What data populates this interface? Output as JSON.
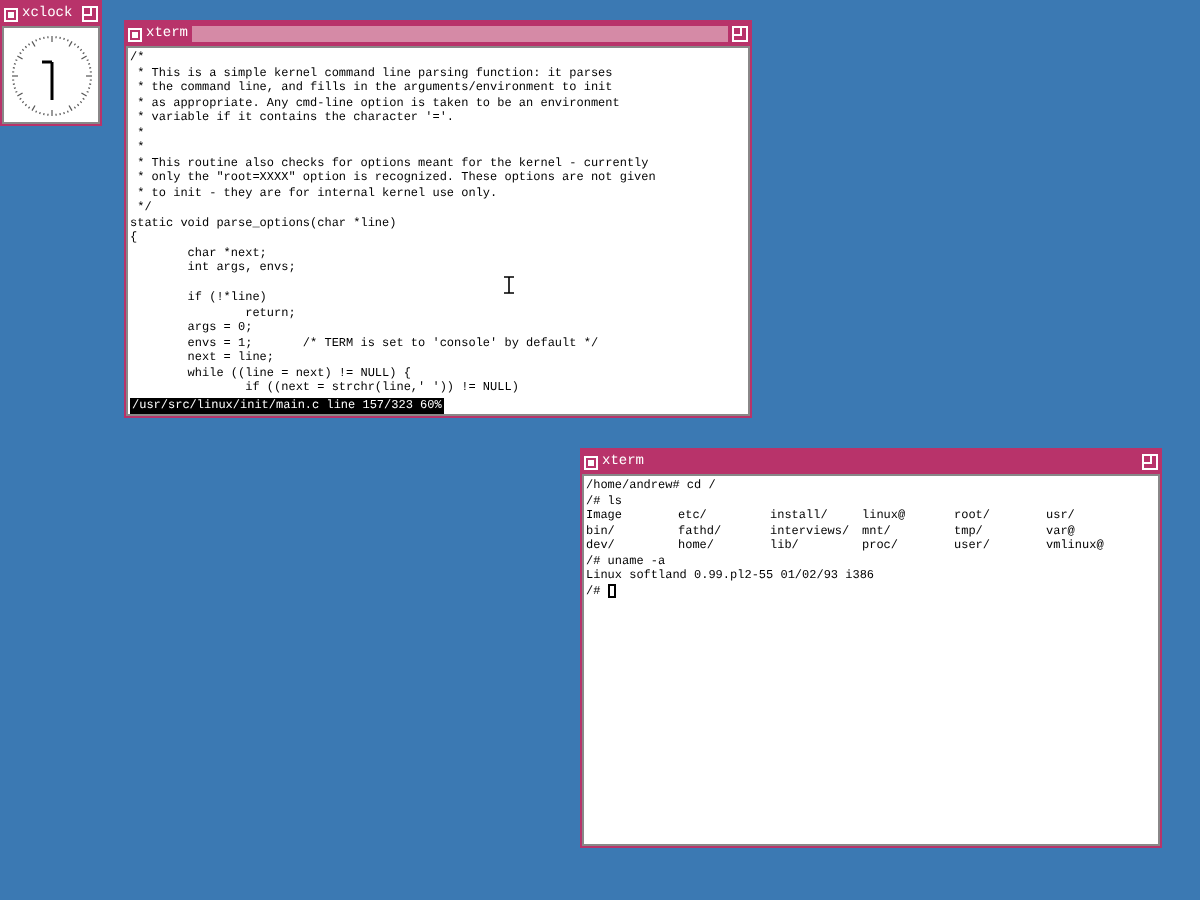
{
  "windows": [
    {
      "kind": "clock",
      "title": "xclock",
      "focused": false
    },
    {
      "kind": "editor",
      "title": "xterm",
      "focused": true,
      "blocks": [
        [
          "/*",
          " * This is a simple kernel command line parsing function: it parses",
          " * the command line, and fills in the arguments/environment to init",
          " * as appropriate. Any cmd-line option is taken to be an environment",
          " * variable if it contains the character '='.",
          " *",
          " *",
          " * This routine also checks for options meant for the kernel - currently",
          " * only the \"root=XXXX\" option is recognized. These options are not given",
          " * to init - they are for internal kernel use only.",
          " */",
          "static void parse_options(char *line)",
          "{",
          "        char *next;",
          "        int args, envs;"
        ],
        [
          "        if (!*line)",
          "                return;",
          "        args = 0;",
          "        envs = 1;       /* TERM is set to 'console' by default */",
          "        next = line;",
          "        while ((line = next) != NULL) {",
          "                if ((next = strchr(line,' ')) != NULL)"
        ]
      ],
      "status": "/usr/src/linux/init/main.c line 157/323 60%"
    },
    {
      "kind": "shell",
      "title": "xterm",
      "focused": false,
      "before": [
        "/home/andrew# cd /",
        "/# ls"
      ],
      "listing": [
        [
          "Image",
          "etc/",
          "install/",
          "linux@",
          "root/",
          "usr/"
        ],
        [
          "bin/",
          "fathd/",
          "interviews/",
          "mnt/",
          "tmp/",
          "var@"
        ],
        [
          "dev/",
          "home/",
          "lib/",
          "proc/",
          "user/",
          "vmlinux@"
        ]
      ],
      "after": [
        "/# uname -a",
        "Linux softland 0.99.pl2-55 01/02/93 i386"
      ],
      "prompt": "/# "
    }
  ]
}
